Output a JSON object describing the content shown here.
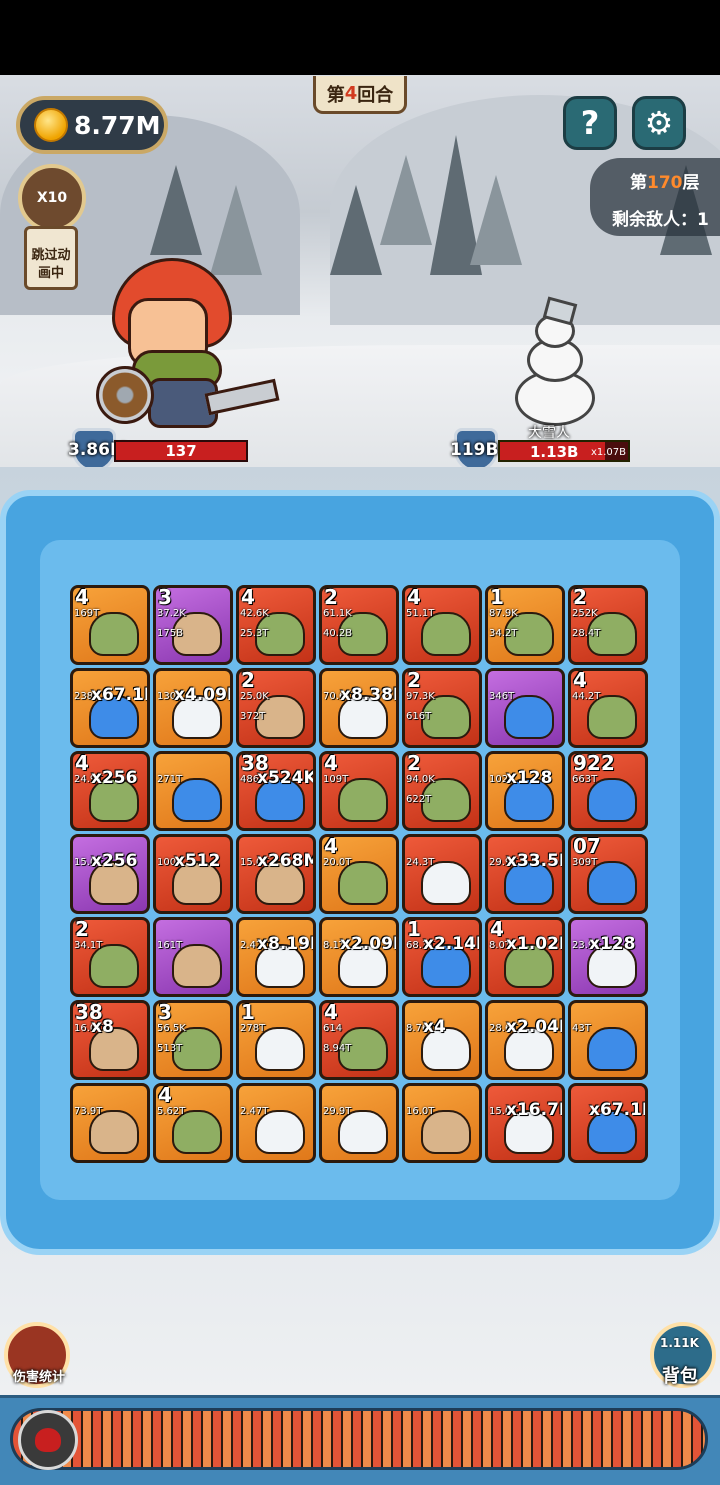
{
  "hud": {
    "round_prefix": "第",
    "round_number": "4",
    "round_suffix": "回合",
    "gold": "8.77M",
    "help": "?",
    "settings": "⚙",
    "floor_prefix": "第",
    "floor_number": "170",
    "floor_suffix": "层",
    "enemies_remaining": "剩余敌人：1",
    "speed": "X10",
    "skip_label": "跳过动画中"
  },
  "player": {
    "armor": "3.86M",
    "hp": "137",
    "status_icons": [
      "sword-icon",
      "bug-icon",
      "puzzle-icon",
      "leaf-icon"
    ]
  },
  "enemy": {
    "name": "大雪人",
    "armor": "119B",
    "hp": "1.13B",
    "multiplier": "x1.07B",
    "hp_fraction": 0.82,
    "status_icons": [
      "sword-icon",
      "skull-icon",
      "empty-icon"
    ]
  },
  "grid": [
    [
      {
        "color": "orange",
        "creature": "green",
        "level": "4",
        "s1": "169T",
        "s2": "",
        "mult": ""
      },
      {
        "color": "purple",
        "creature": "tan",
        "level": "3",
        "s1": "37.2K",
        "s2": "175B",
        "mult": ""
      },
      {
        "color": "red",
        "creature": "green",
        "level": "4",
        "s1": "42.6K",
        "s2": "25.3T",
        "mult": ""
      },
      {
        "color": "red",
        "creature": "green",
        "level": "2",
        "s1": "61.1K",
        "s2": "40.2B",
        "mult": ""
      },
      {
        "color": "red",
        "creature": "green",
        "level": "4",
        "s1": "51.1T",
        "s2": "",
        "mult": ""
      },
      {
        "color": "orange",
        "creature": "green",
        "level": "1",
        "s1": "87.9K",
        "s2": "34.2T",
        "mult": ""
      },
      {
        "color": "red",
        "creature": "green",
        "level": "2",
        "s1": "252K",
        "s2": "28.4T",
        "mult": ""
      }
    ],
    [
      {
        "color": "orange",
        "creature": "blue",
        "level": "",
        "s1": "238T",
        "s2": "",
        "mult": "x67.1M"
      },
      {
        "color": "orange",
        "creature": "white",
        "level": "",
        "s1": "130T",
        "s2": "",
        "mult": "x4.09K"
      },
      {
        "color": "red",
        "creature": "tan",
        "level": "2",
        "s1": "25.0K",
        "s2": "372T",
        "mult": ""
      },
      {
        "color": "orange",
        "creature": "white",
        "level": "",
        "s1": "70.6T",
        "s2": "",
        "mult": "x8.38M"
      },
      {
        "color": "red",
        "creature": "green",
        "level": "2",
        "s1": "97.3K",
        "s2": "616T",
        "mult": ""
      },
      {
        "color": "purple",
        "creature": "blue",
        "level": "",
        "s1": "346T",
        "s2": "",
        "mult": ""
      },
      {
        "color": "red",
        "creature": "green",
        "level": "4",
        "s1": "44.2T",
        "s2": "",
        "mult": ""
      }
    ],
    [
      {
        "color": "red",
        "creature": "green",
        "level": "4",
        "s1": "24.9T",
        "s2": "",
        "mult": "x256"
      },
      {
        "color": "orange",
        "creature": "blue",
        "level": "",
        "s1": "271T",
        "s2": "",
        "mult": ""
      },
      {
        "color": "red",
        "creature": "blue",
        "level": "38",
        "s1": "486T",
        "s2": "",
        "mult": "x524K"
      },
      {
        "color": "red",
        "creature": "green",
        "level": "4",
        "s1": "109T",
        "s2": "",
        "mult": ""
      },
      {
        "color": "red",
        "creature": "green",
        "level": "2",
        "s1": "94.0K",
        "s2": "622T",
        "mult": ""
      },
      {
        "color": "orange",
        "creature": "blue",
        "level": "",
        "s1": "102T",
        "s2": "",
        "mult": "x128"
      },
      {
        "color": "red",
        "creature": "blue",
        "level": "922",
        "s1": "663T",
        "s2": "",
        "mult": ""
      }
    ],
    [
      {
        "color": "purple",
        "creature": "tan",
        "level": "",
        "s1": "15.0T",
        "s2": "",
        "mult": "x256"
      },
      {
        "color": "red",
        "creature": "tan",
        "level": "",
        "s1": "100T",
        "s2": "",
        "mult": "x512"
      },
      {
        "color": "red",
        "creature": "tan",
        "level": "",
        "s1": "15.0T",
        "s2": "",
        "mult": "x268M"
      },
      {
        "color": "orange",
        "creature": "green",
        "level": "4",
        "s1": "20.0T",
        "s2": "",
        "mult": ""
      },
      {
        "color": "red",
        "creature": "white",
        "level": "",
        "s1": "24.3T",
        "s2": "",
        "mult": ""
      },
      {
        "color": "red",
        "creature": "blue",
        "level": "",
        "s1": "29.9T",
        "s2": "",
        "mult": "x33.5M"
      },
      {
        "color": "red",
        "creature": "blue",
        "level": "07",
        "s1": "309T",
        "s2": "",
        "mult": ""
      }
    ],
    [
      {
        "color": "red",
        "creature": "green",
        "level": "2",
        "s1": "34.1T",
        "s2": "",
        "mult": ""
      },
      {
        "color": "purple",
        "creature": "tan",
        "level": "",
        "s1": "161T",
        "s2": "",
        "mult": ""
      },
      {
        "color": "orange",
        "creature": "white",
        "level": "",
        "s1": "2.47T",
        "s2": "",
        "mult": "x8.19K"
      },
      {
        "color": "orange",
        "creature": "white",
        "level": "",
        "s1": "8.1T",
        "s2": "",
        "mult": "x2.09M"
      },
      {
        "color": "red",
        "creature": "blue",
        "level": "1",
        "s1": "68.3T",
        "s2": "",
        "mult": "x2.14B"
      },
      {
        "color": "red",
        "creature": "green",
        "level": "4",
        "s1": "8.0T",
        "s2": "",
        "mult": "x1.02K"
      },
      {
        "color": "purple",
        "creature": "white",
        "level": "",
        "s1": "23.9T",
        "s2": "",
        "mult": "x128"
      }
    ],
    [
      {
        "color": "red",
        "creature": "tan",
        "level": "38",
        "s1": "16.0T",
        "s2": "",
        "mult": "x8"
      },
      {
        "color": "orange",
        "creature": "green",
        "level": "3",
        "s1": "56.5K",
        "s2": "513T",
        "mult": ""
      },
      {
        "color": "orange",
        "creature": "white",
        "level": "1",
        "s1": "278T",
        "s2": "",
        "mult": ""
      },
      {
        "color": "red",
        "creature": "green",
        "level": "4",
        "s1": "614",
        "s2": "8.94T",
        "mult": ""
      },
      {
        "color": "orange",
        "creature": "white",
        "level": "",
        "s1": "8.76T",
        "s2": "",
        "mult": "x4"
      },
      {
        "color": "orange",
        "creature": "white",
        "level": "",
        "s1": "28.6T",
        "s2": "",
        "mult": "x2.04K"
      },
      {
        "color": "orange",
        "creature": "blue",
        "level": "",
        "s1": "43T",
        "s2": "",
        "mult": ""
      }
    ],
    [
      {
        "color": "orange",
        "creature": "tan",
        "level": "",
        "s1": "73.9T",
        "s2": "",
        "mult": ""
      },
      {
        "color": "orange",
        "creature": "green",
        "level": "4",
        "s1": "5.62T",
        "s2": "",
        "mult": ""
      },
      {
        "color": "orange",
        "creature": "white",
        "level": "",
        "s1": "2.47T",
        "s2": "",
        "mult": ""
      },
      {
        "color": "orange",
        "creature": "white",
        "level": "",
        "s1": "29.9T",
        "s2": "",
        "mult": ""
      },
      {
        "color": "orange",
        "creature": "tan",
        "level": "",
        "s1": "16.0T",
        "s2": "",
        "mult": ""
      },
      {
        "color": "red",
        "creature": "white",
        "level": "",
        "s1": "15.0T",
        "s2": "",
        "mult": "x16.7M"
      },
      {
        "color": "red",
        "creature": "blue",
        "level": "",
        "s1": "",
        "s2": "",
        "mult": "x67.1M"
      }
    ]
  ],
  "bottom": {
    "damage_stats_label": "伤害统计",
    "bag_count": "1.11K",
    "bag_label": "背包"
  }
}
